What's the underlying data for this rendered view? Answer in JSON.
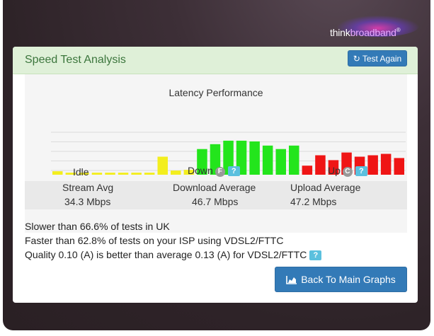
{
  "brand": {
    "logo_prefix": "think",
    "logo_suffix": "broadband",
    "logo_mark": "®"
  },
  "panel": {
    "title": "Speed Test Analysis",
    "test_again_label": "Test Again",
    "test_again_icon": "refresh-icon"
  },
  "chart_data": {
    "type": "bar",
    "title": "Latency Performance",
    "xlabel": "",
    "ylabel": "",
    "grid": true,
    "phases": [
      "Idle",
      "Down",
      "Up"
    ],
    "phase_badges": {
      "Down": "F",
      "Up": "C"
    },
    "series": [
      {
        "phase": "Idle",
        "color": "#f3ee1e",
        "values": [
          5,
          3,
          3,
          3,
          3,
          3,
          3,
          3,
          26,
          6,
          7
        ]
      },
      {
        "phase": "Down",
        "color": "#23e51c",
        "values": [
          37,
          44,
          49,
          49,
          48,
          42,
          37,
          42
        ]
      },
      {
        "phase": "Up",
        "color": "#ef1515",
        "values": [
          13,
          28,
          21,
          32,
          26,
          28,
          30,
          24
        ]
      }
    ],
    "ylim": [
      0,
      55
    ]
  },
  "stats": {
    "stream_avg_label": "Stream Avg",
    "stream_avg_value": "34.3 Mbps",
    "download_label": "Download Average",
    "download_value": "46.7 Mbps",
    "upload_label": "Upload Average",
    "upload_value": "47.2 Mbps"
  },
  "summary": {
    "line1": "Slower than 66.6% of tests in UK",
    "line2": "Faster than 62.8% of tests on your ISP using VDSL2/FTTC",
    "line3": "Quality 0.10 (A) is better than average 0.13 (A) for VDSL2/FTTC"
  },
  "help_label": "?",
  "back_button_label": "Back To Main Graphs",
  "back_button_icon": "area-chart-icon"
}
